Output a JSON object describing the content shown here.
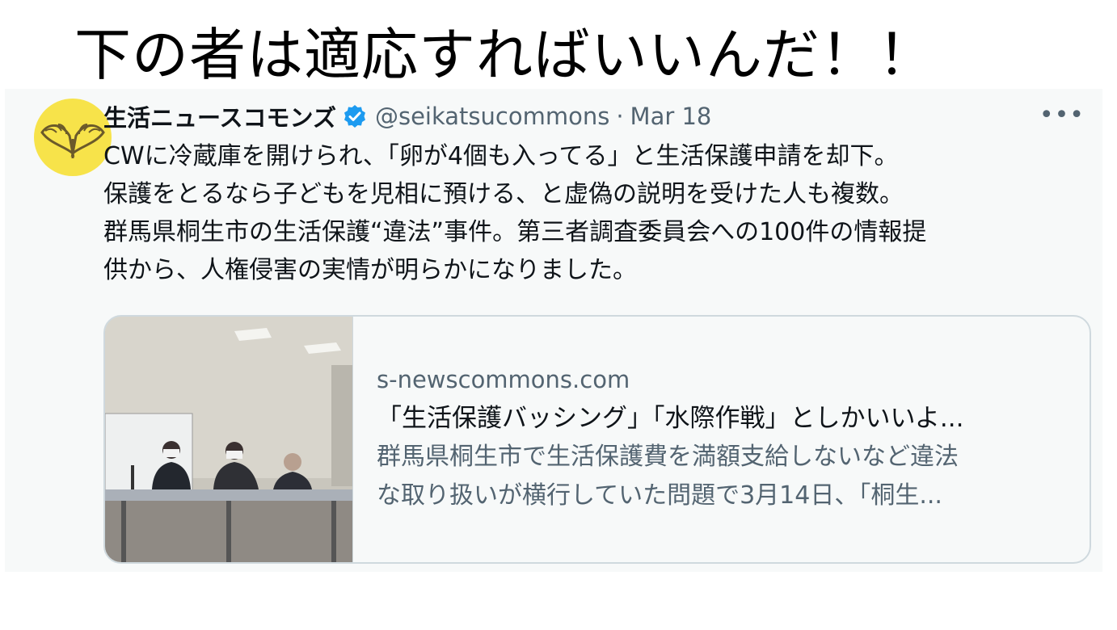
{
  "headline": "下の者は適応すればいいんだ！！",
  "tweet": {
    "display_name": "生活ニュースコモンズ",
    "handle": "@seikatsucommons",
    "separator": "·",
    "date": "Mar 18",
    "more_label": "•••",
    "body_lines": [
      "CWに冷蔵庫を開けられ、「卵が4個も入ってる」と生活保護申請を却下。",
      "保護をとるなら子どもを児相に預ける、と虚偽の説明を受けた人も複数。",
      "群馬県桐生市の生活保護“違法”事件。第三者調査委員会への100件の情報提",
      "供から、人権侵害の実情が明らかになりました。"
    ],
    "card": {
      "domain": "s-newscommons.com",
      "title": "「生活保護バッシング」「水際作戦」としかいいよ...",
      "description_lines": [
        "群馬県桐生市で生活保護費を満額支給しないなど違法",
        "な取り扱いが横行していた問題で3月14日、「桐生..."
      ]
    }
  },
  "colors": {
    "name": "#0f1419",
    "secondary": "#536471",
    "verified": "#1d9bf0",
    "avatar_bg": "#f7e34a",
    "card_border": "#cfd9de"
  },
  "icons": {
    "verified": "verified-badge-icon",
    "more": "more-options-icon",
    "avatar_logo": "ginkgo-leaf-logo"
  }
}
